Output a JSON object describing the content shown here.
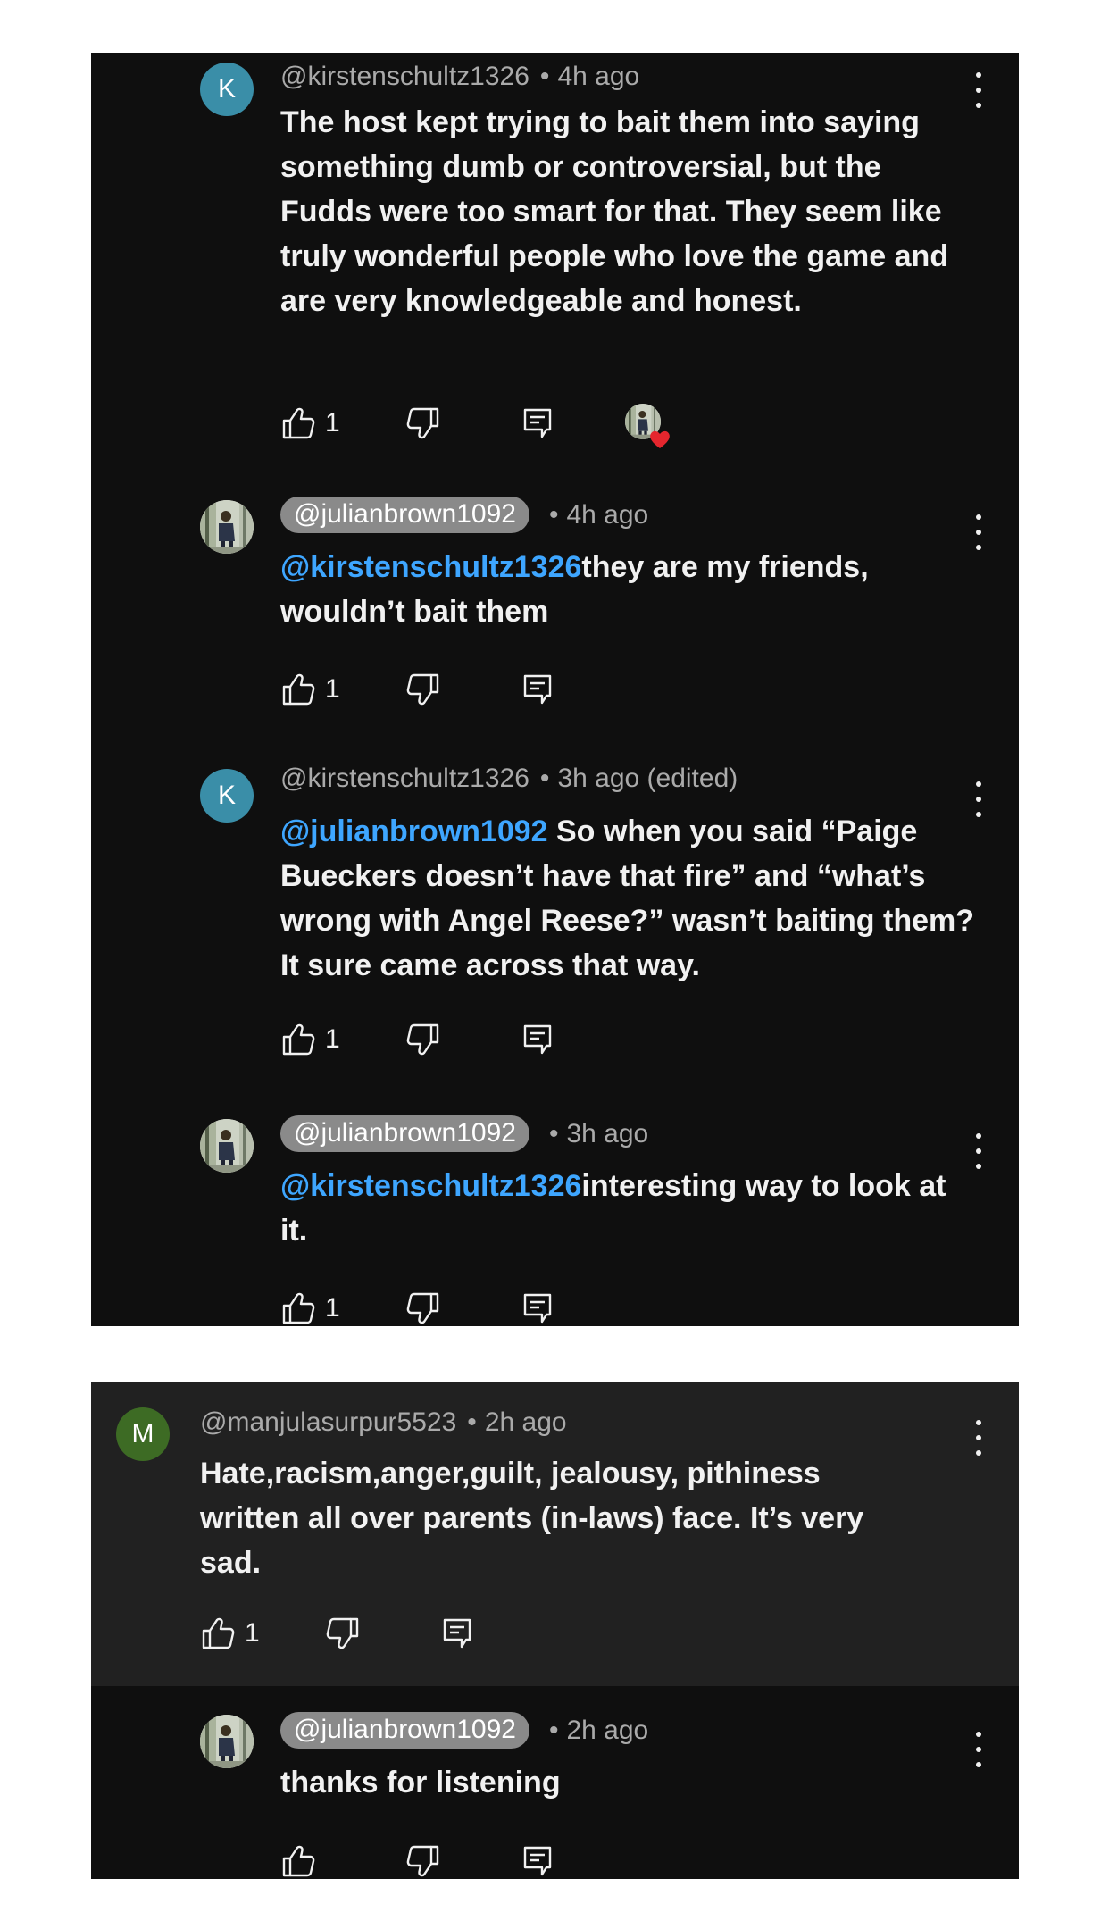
{
  "thread": {
    "replies": [
      {
        "avatar_letter": "K",
        "avatar_color": "#3a8ea8",
        "handle": "@kirstenschultz1326",
        "time": "4h ago",
        "text": "The host kept trying to bait them into saying something dumb or controversial, but the Fudds were too smart for that. They seem like truly wonderful people who love the game and are very knowledgeable and honest.",
        "likes": "1",
        "creator_heart": true
      },
      {
        "handle": "@julianbrown1092",
        "time": "4h ago",
        "mention": "@kirstenschultz1326",
        "text": "they are my friends, wouldn’t bait them",
        "likes": "1"
      },
      {
        "avatar_letter": "K",
        "avatar_color": "#3a8ea8",
        "handle": "@kirstenschultz1326",
        "time": "3h ago (edited)",
        "mention": "@julianbrown1092",
        "text": " So when you said  “Paige Bueckers doesn’t have that fire” and “what’s wrong with Angel Reese?” wasn’t baiting them? It sure came across that way.",
        "likes": "1"
      },
      {
        "handle": "@julianbrown1092",
        "time": "3h ago",
        "mention": "@kirstenschultz1326",
        "text": "interesting way to look at it.",
        "likes": "1"
      }
    ]
  },
  "thread2": {
    "top": {
      "avatar_letter": "M",
      "avatar_color": "#3d6b24",
      "handle": "@manjulasurpur5523",
      "time": "2h ago",
      "text": "Hate,racism,anger,guilt, jealousy, pithiness written all over parents (in-laws) face. It’s very sad.",
      "likes": "1"
    },
    "reply": {
      "handle": "@julianbrown1092",
      "time": "2h ago",
      "text": "thanks for listening",
      "likes": ""
    }
  },
  "separator": "•",
  "colors": {
    "background": "#0f0f0f",
    "top_comment_bg": "#212121",
    "mention": "#3ea6ff",
    "meta": "#aaaaaa",
    "pill": "#8a8a8a",
    "heart": "#e5262e"
  },
  "icons": {
    "like": "thumbs-up-icon",
    "dislike": "thumbs-down-icon",
    "reply": "reply-icon",
    "more": "more-vertical-icon",
    "heart": "creator-heart-icon"
  }
}
